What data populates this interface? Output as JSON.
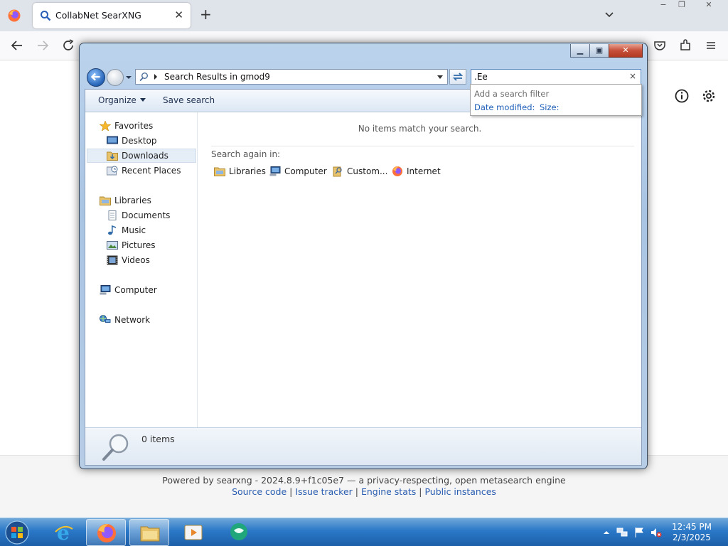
{
  "browser": {
    "tab_title": "CollabNet SearXNG",
    "new_tab_label": "+",
    "window_controls": [
      "−",
      "❐",
      "✕"
    ]
  },
  "page": {
    "footer_line1": "Powered by searxng - 2024.8.9+f1c05e7 — a privacy-respecting, open metasearch engine",
    "footer_links": [
      "Source code",
      "Issue tracker",
      "Engine stats",
      "Public instances"
    ],
    "footer_sep": " | "
  },
  "explorer": {
    "address": "Search Results in gmod9",
    "search_value": ".Ee",
    "search_clear": "×",
    "filter": {
      "heading": "Add a search filter",
      "options": [
        "Date modified:",
        "Size:"
      ]
    },
    "toolbar": {
      "organize": "Organize",
      "save_search": "Save search"
    },
    "nav": {
      "favorites": "Favorites",
      "desktop": "Desktop",
      "downloads": "Downloads",
      "recent_places": "Recent Places",
      "libraries": "Libraries",
      "documents": "Documents",
      "music": "Music",
      "pictures": "Pictures",
      "videos": "Videos",
      "computer": "Computer",
      "network": "Network"
    },
    "main": {
      "empty_message": "No items match your search.",
      "search_again": "Search again in:",
      "locations": [
        "Libraries",
        "Computer",
        "Custom...",
        "Internet"
      ]
    },
    "details": {
      "count": "0 items"
    }
  },
  "taskbar": {
    "time": "12:45 PM",
    "date": "2/3/2025"
  },
  "colors": {
    "taskbar": "#2a78c8",
    "link": "#1f5fb8",
    "close_button": "#c7503a"
  }
}
